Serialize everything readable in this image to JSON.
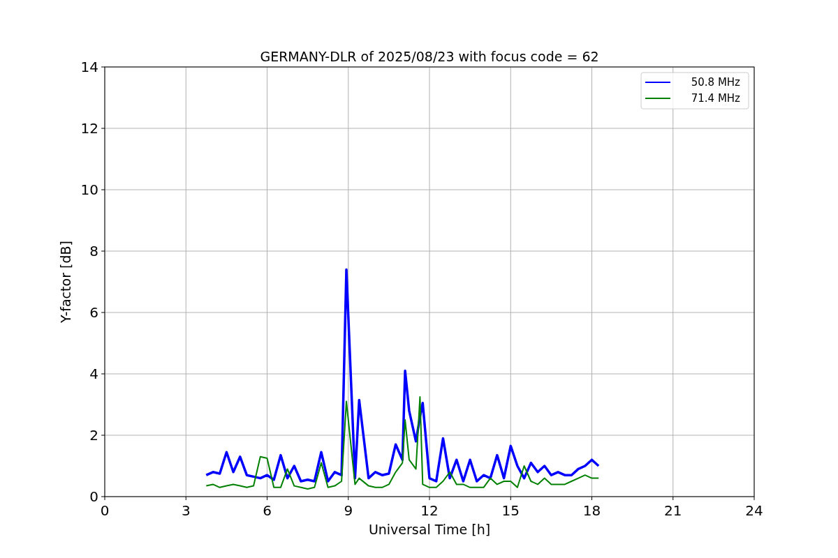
{
  "figure": {
    "chart_data": {
      "type": "line",
      "title": "GERMANY-DLR of 2025/08/23 with focus code = 62",
      "xlabel": "Universal Time [h]",
      "ylabel": "Y-factor [dB]",
      "x": [
        3.75,
        4,
        4.25,
        4.5,
        4.75,
        5,
        5.25,
        5.5,
        5.75,
        6,
        6.25,
        6.5,
        6.75,
        7,
        7.25,
        7.5,
        7.75,
        8,
        8.25,
        8.5,
        8.75,
        8.93,
        9.25,
        9.4,
        9.75,
        10,
        10.25,
        10.5,
        10.75,
        11,
        11.1,
        11.25,
        11.5,
        11.65,
        11.75,
        12,
        12.25,
        12.5,
        12.75,
        13,
        13.25,
        13.5,
        13.75,
        14,
        14.25,
        14.5,
        14.75,
        15,
        15.25,
        15.5,
        15.75,
        16,
        16.25,
        16.5,
        16.75,
        17,
        17.25,
        17.5,
        17.75,
        18,
        18.25
      ],
      "series": [
        {
          "name": "50.8 MHz",
          "color": "#0000ff",
          "values": [
            0.7,
            0.8,
            0.75,
            1.45,
            0.8,
            1.3,
            0.7,
            0.65,
            0.6,
            0.7,
            0.55,
            1.35,
            0.6,
            1.0,
            0.5,
            0.55,
            0.5,
            1.45,
            0.5,
            0.8,
            0.7,
            7.4,
            0.6,
            3.15,
            0.6,
            0.8,
            0.7,
            0.75,
            1.7,
            1.2,
            4.1,
            2.8,
            1.8,
            2.6,
            3.05,
            0.6,
            0.5,
            1.9,
            0.6,
            1.2,
            0.5,
            1.2,
            0.5,
            0.7,
            0.6,
            1.35,
            0.6,
            1.65,
            1.0,
            0.6,
            1.1,
            0.8,
            1.0,
            0.7,
            0.8,
            0.7,
            0.7,
            0.9,
            1.0,
            1.2,
            1.0
          ]
        },
        {
          "name": "71.4 MHz",
          "color": "#008000",
          "values": [
            0.35,
            0.4,
            0.3,
            0.35,
            0.4,
            0.35,
            0.3,
            0.35,
            1.3,
            1.25,
            0.3,
            0.3,
            0.9,
            0.35,
            0.3,
            0.25,
            0.3,
            1.1,
            0.3,
            0.35,
            0.5,
            3.1,
            0.4,
            0.6,
            0.35,
            0.3,
            0.3,
            0.4,
            0.8,
            1.1,
            2.5,
            1.2,
            0.9,
            3.25,
            0.4,
            0.3,
            0.3,
            0.5,
            0.8,
            0.4,
            0.4,
            0.3,
            0.3,
            0.3,
            0.6,
            0.4,
            0.5,
            0.5,
            0.3,
            1.0,
            0.5,
            0.4,
            0.6,
            0.4,
            0.4,
            0.4,
            0.5,
            0.6,
            0.7,
            0.6,
            0.6
          ]
        }
      ],
      "grid": true,
      "legend": true,
      "xlim": [
        0,
        24
      ],
      "ylim": [
        0,
        14
      ],
      "xticks": [
        0,
        3,
        6,
        9,
        12,
        15,
        18,
        21,
        24
      ],
      "yticks": [
        0,
        2,
        4,
        6,
        8,
        10,
        12,
        14
      ]
    }
  }
}
